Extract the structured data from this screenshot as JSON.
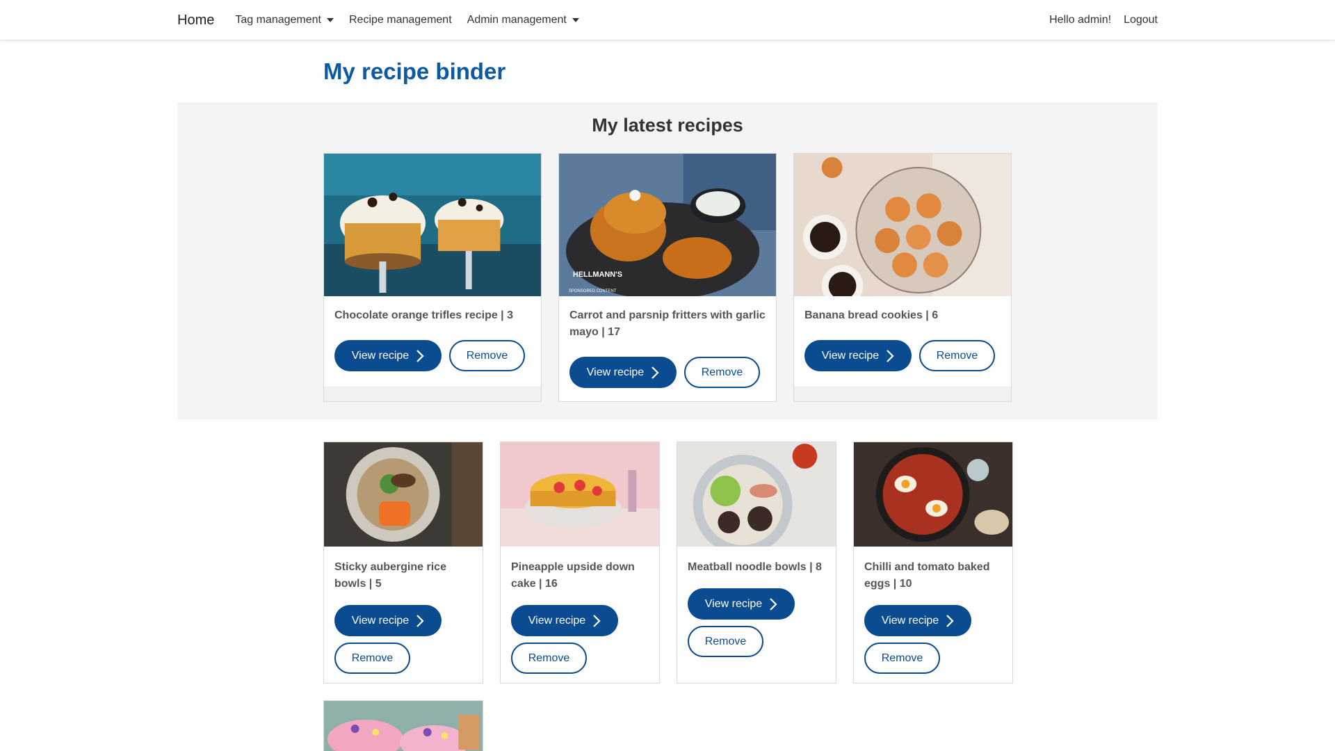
{
  "nav": {
    "brand": "Home",
    "tag_management": "Tag management",
    "recipe_management": "Recipe management",
    "admin_management": "Admin management",
    "greeting": "Hello admin!",
    "logout": "Logout"
  },
  "page_title": "My recipe binder",
  "latest": {
    "heading": "My latest recipes",
    "cards": [
      {
        "title": "Chocolate orange trifles recipe | 3",
        "view": "View recipe",
        "remove": "Remove",
        "image": "chocolate-trifle-photo"
      },
      {
        "title": "Carrot and parsnip fritters with garlic mayo | 17",
        "view": "View recipe",
        "remove": "Remove",
        "image": "fritters-photo",
        "image_text": "HELLMANN'S",
        "image_subtext": "SPONSORED CONTENT"
      },
      {
        "title": "Banana bread cookies | 6",
        "view": "View recipe",
        "remove": "Remove",
        "image": "cookies-photo"
      }
    ]
  },
  "grid": {
    "cards": [
      {
        "title": "Sticky aubergine rice bowls | 5",
        "view": "View recipe",
        "remove": "Remove",
        "image": "rice-bowl-photo"
      },
      {
        "title": "Pineapple upside down cake | 16",
        "view": "View recipe",
        "remove": "Remove",
        "image": "pineapple-cake-photo"
      },
      {
        "title": "Meatball noodle bowls | 8",
        "view": "View recipe",
        "remove": "Remove",
        "image": "meatball-bowl-photo"
      },
      {
        "title": "Chilli and tomato baked eggs | 10",
        "view": "View recipe",
        "remove": "Remove",
        "image": "baked-eggs-photo"
      },
      {
        "image": "iced-cakes-photo"
      }
    ]
  },
  "colors": {
    "primary": "#0b4c91",
    "title_blue": "#0b5aa2",
    "section_bg": "#f4f4f4"
  }
}
